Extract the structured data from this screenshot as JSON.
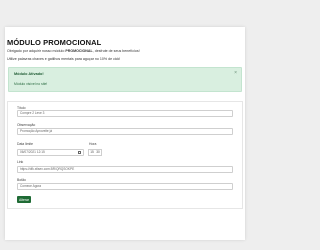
{
  "page": {
    "title": "MÓDULO PROMOCIONAL",
    "subtitle_prefix": "Obrigado por adquirir nosso módulo ",
    "subtitle_bold": "PROMOCIONAL",
    "subtitle_suffix": ", desfrute de seus benefícios!",
    "hint": "Utilize palavras chaves e gatilhos mentais para aguçar no 10% de cick!"
  },
  "alert": {
    "title": "Módulo Ativado!",
    "text": "Módulo visível no site!",
    "close_glyph": "×",
    "colors": {
      "background": "#d9efe0",
      "text": "#1d5a32"
    }
  },
  "form": {
    "fields": {
      "titulo": {
        "label": "Título",
        "value": "Compre 2 Leve 3"
      },
      "observacao": {
        "label": "Observação",
        "value": "Promoção Aproveite já"
      },
      "data_limite": {
        "label": "Data limite",
        "value": "06/07/2021 12:15"
      },
      "hora": {
        "label": "Hora",
        "hour": "15",
        "minute": "30"
      },
      "link": {
        "label": "Link",
        "value": "https://dfk.xtlsex.com.BR/QRQSOKPE"
      },
      "botao": {
        "label": "Botão",
        "value": "Comece Agora"
      }
    },
    "submit_label": "Alterar",
    "accent_color": "#1f6b35"
  }
}
